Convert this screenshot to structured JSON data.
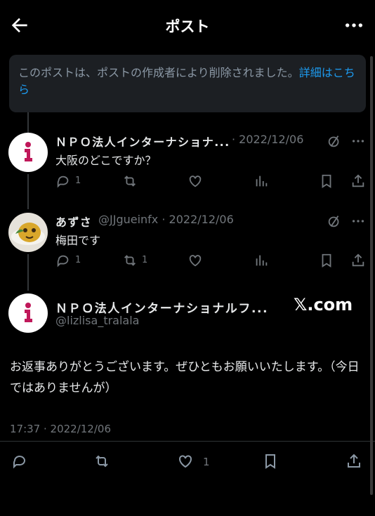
{
  "header": {
    "title": "ポスト",
    "back_icon": "arrow-left-icon",
    "more_icon": "more-horizontal-icon"
  },
  "deleted_notice": {
    "text": "このポストは、ポストの作成者により削除されました。",
    "link_text": "詳細はこちら"
  },
  "replies": [
    {
      "author": "ＮＰＯ法人インターナショナ...",
      "meta": "· 2022/12/06",
      "text": "大阪のどこですか？",
      "counts": {
        "reply": "1",
        "repost": "",
        "like": ""
      }
    },
    {
      "author": "あずさ",
      "meta": "@JJgueinfx · 2022/12/06",
      "text": "梅田です",
      "counts": {
        "reply": "1",
        "repost": "1",
        "like": ""
      }
    }
  ],
  "main_post": {
    "author": "ＮＰＯ法人インターナショナルフ...",
    "handle": "@lizlisa_tralala",
    "watermark": "𝕏.com",
    "text": "お返事ありがとうございます。ぜひともお願いいたします。（今日ではありませんが）",
    "timestamp": "17:37 · 2022/12/06",
    "like_count": "1"
  },
  "colors": {
    "background": "#000000",
    "link": "#1d9bf0",
    "secondary": "#71767b",
    "avatar_brand": "#c0185a"
  }
}
